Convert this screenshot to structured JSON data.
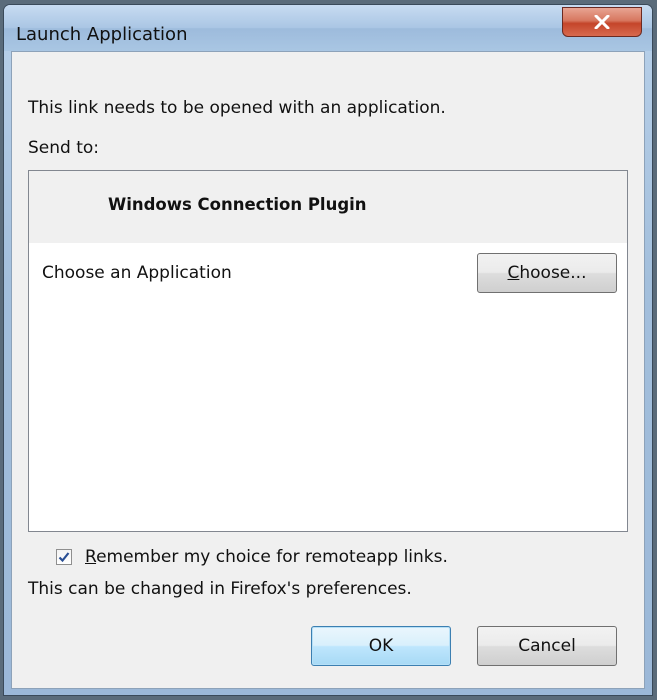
{
  "window": {
    "title": "Launch Application",
    "close_icon": "close-x-icon"
  },
  "dialog": {
    "message": "This link needs to be opened with an application.",
    "send_to_label": "Send to:",
    "list": {
      "header": "Windows Connection Plugin",
      "items": [
        {
          "label": "Choose an Application",
          "button_accel": "C",
          "button_rest": "hoose..."
        }
      ]
    },
    "remember": {
      "checked": true,
      "accel": "R",
      "label_rest": "emember my choice for remoteapp links."
    },
    "prefs_note": "This can be changed in Firefox's preferences.",
    "buttons": {
      "ok": "OK",
      "cancel": "Cancel"
    }
  },
  "colors": {
    "title_bar": "#aac6e4",
    "close_button": "#c4452a",
    "dialog_bg": "#f0f0f0",
    "default_button": "#bee6fd"
  }
}
